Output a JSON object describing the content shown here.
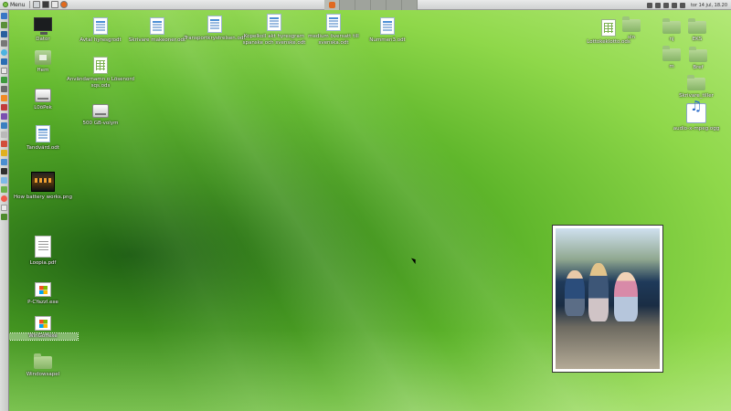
{
  "top_panel": {
    "menu_label": "Menu",
    "clock": "tor 14 jul, 18.20"
  },
  "desktop_icons": [
    {
      "label": "Dator",
      "icon": "computer-icon"
    },
    {
      "label": "Hem",
      "icon": "home-folder-icon"
    },
    {
      "label": "L0öPek",
      "icon": "drive-icon"
    },
    {
      "label": "Tandvärd.odt",
      "icon": "document-icon"
    },
    {
      "label": "How battery works.png",
      "icon": "image-icon"
    },
    {
      "label": "Loopia.pdf",
      "icon": "pdf-icon"
    },
    {
      "label": "P-CYazzl.exe",
      "icon": "exe-icon"
    },
    {
      "label": "WinGoffexe",
      "icon": "exe-icon",
      "selected": true
    },
    {
      "label": "Windowsapel",
      "icon": "folder-icon"
    },
    {
      "label": "Avtal hyresgrodt",
      "icon": "document-icon"
    },
    {
      "label": "Användarnamn o Lösenord sqs.ods",
      "icon": "spreadsheet-icon"
    },
    {
      "label": "500 GB-volym",
      "icon": "drive-icon"
    },
    {
      "label": "Skrivare makeoner.odt",
      "icon": "document-icon"
    },
    {
      "label": "Transportkrystrelsen.odt",
      "icon": "document-icon"
    },
    {
      "label": "Kopelkoll akt hyresgram spanske och svenske.odt",
      "icon": "document-icon"
    },
    {
      "label": "medium översatt till svenska.odt",
      "icon": "document-icon"
    },
    {
      "label": "Nummen3.odt",
      "icon": "document-icon"
    },
    {
      "label": "Lottokeklotto.ods",
      "icon": "spreadsheet-icon"
    },
    {
      "label": "sln",
      "icon": "folder-icon"
    },
    {
      "label": "nj",
      "icon": "folder-icon"
    },
    {
      "label": "EKS",
      "icon": "folder-icon"
    },
    {
      "label": "m",
      "icon": "folder-icon"
    },
    {
      "label": "Bref",
      "icon": "folder-icon"
    },
    {
      "label": "Skrivare_tiller",
      "icon": "folder-icon"
    },
    {
      "label": "audio-x-mpeg.ogg",
      "icon": "audio-icon"
    }
  ]
}
